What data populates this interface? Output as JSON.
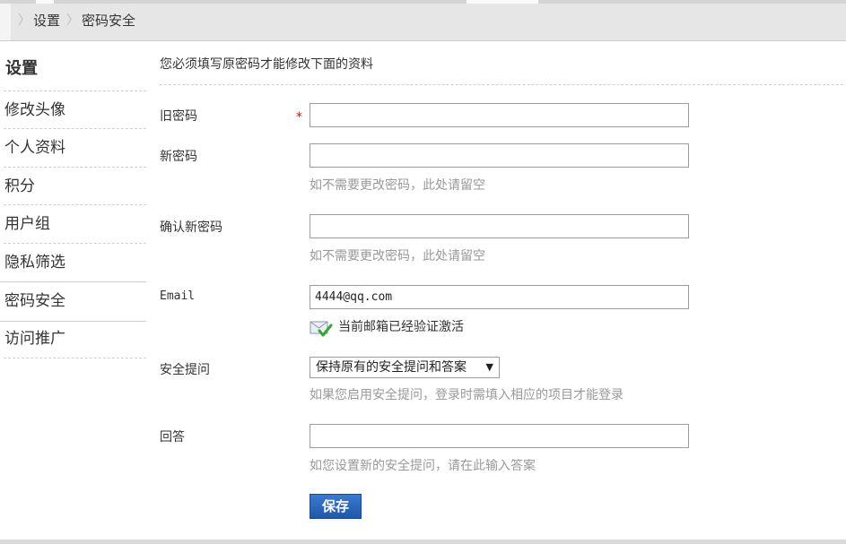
{
  "breadcrumb": {
    "items": [
      "设置",
      "密码安全"
    ]
  },
  "sidebar": {
    "title": "设置",
    "items": [
      {
        "label": "修改头像"
      },
      {
        "label": "个人资料"
      },
      {
        "label": "积分"
      },
      {
        "label": "用户组"
      },
      {
        "label": "隐私筛选"
      },
      {
        "label": "密码安全",
        "active": true
      },
      {
        "label": "访问推广"
      }
    ]
  },
  "form": {
    "notice": "您必须填写原密码才能修改下面的资料",
    "old_password": {
      "label": "旧密码",
      "required_mark": "*",
      "value": ""
    },
    "new_password": {
      "label": "新密码",
      "value": "",
      "hint": "如不需要更改密码，此处请留空"
    },
    "confirm_password": {
      "label": "确认新密码",
      "value": "",
      "hint": "如不需要更改密码，此处请留空"
    },
    "email": {
      "label": "Email",
      "value": "4444@qq.com",
      "status": "当前邮箱已经验证激活",
      "status_icon": "envelope-check-icon"
    },
    "security_question": {
      "label": "安全提问",
      "selected": "保持原有的安全提问和答案",
      "hint": "如果您启用安全提问，登录时需填入相应的项目才能登录"
    },
    "answer": {
      "label": "回答",
      "value": "",
      "hint": "如您设置新的安全提问，请在此输入答案"
    },
    "save_label": "保存"
  },
  "colors": {
    "button": "#2a63b8",
    "required": "#e00000",
    "hint": "#999999",
    "verified": "#3aa335"
  }
}
